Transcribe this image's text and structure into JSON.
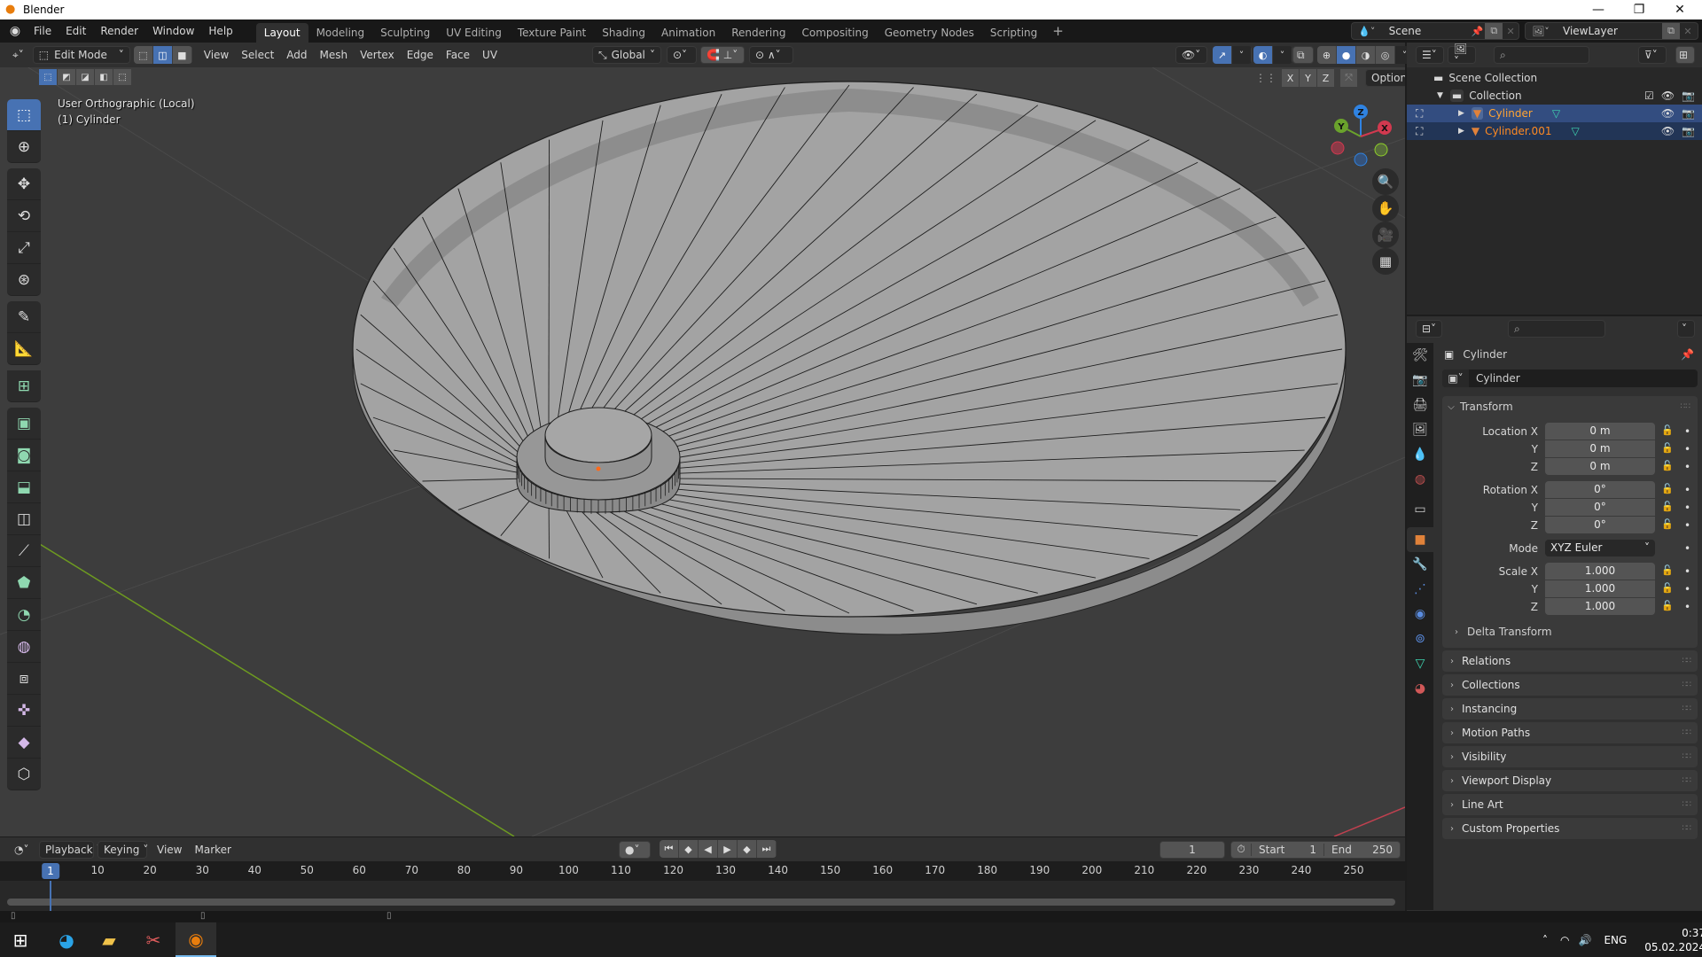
{
  "window": {
    "title": "Blender",
    "controls": [
      "minimize",
      "restore",
      "close"
    ]
  },
  "topbar": {
    "menus": [
      "File",
      "Edit",
      "Render",
      "Window",
      "Help"
    ],
    "workspaces": [
      "Layout",
      "Modeling",
      "Sculpting",
      "UV Editing",
      "Texture Paint",
      "Shading",
      "Animation",
      "Rendering",
      "Compositing",
      "Geometry Nodes",
      "Scripting"
    ],
    "active_workspace": "Layout",
    "add_workspace": "+",
    "scene": "Scene",
    "view_layer": "ViewLayer"
  },
  "viewport_header": {
    "mode": "Edit Mode",
    "menus": [
      "View",
      "Select",
      "Add",
      "Mesh",
      "Vertex",
      "Edge",
      "Face",
      "UV"
    ],
    "transform_orientation": "Global",
    "select_mode_active": "edge",
    "shading_active": "solid",
    "options_label": "Options",
    "axis_buttons": [
      "X",
      "Y",
      "Z"
    ]
  },
  "viewport": {
    "view_name": "User Orthographic (Local)",
    "object_info": "(1) Cylinder",
    "gizmo": {
      "x": "X",
      "y": "Y",
      "z": "Z"
    },
    "colors": {
      "background": "#3d3d3d",
      "mesh_face": "#a5a5a5",
      "mesh_side": "#8c8c8c",
      "grid_x": "#c0404f",
      "grid_y": "#6e9b20",
      "selection": "#4772b3",
      "active_vertex": "#ff6a1a"
    }
  },
  "toolbar": {
    "tools": [
      "select-box",
      "cursor",
      "move",
      "rotate",
      "scale",
      "transform",
      "annotate",
      "measure",
      "add-cube",
      "extrude-region",
      "inset-faces",
      "bevel",
      "loop-cut",
      "knife",
      "poly-build",
      "spin",
      "smooth",
      "edge-slide",
      "shrink-fatten",
      "shear",
      "rip-region"
    ],
    "active_tool": "select-box"
  },
  "outliner": {
    "root": "Scene Collection",
    "collection": "Collection",
    "objects": [
      {
        "name": "Cylinder",
        "selected": true,
        "active": true
      },
      {
        "name": "Cylinder.001",
        "selected": true,
        "active": false
      }
    ]
  },
  "properties": {
    "object_name_header": "Cylinder",
    "object_name_field": "Cylinder",
    "transform_title": "Transform",
    "location": {
      "label": "Location X",
      "x": "0 m",
      "y": "0 m",
      "z": "0 m"
    },
    "rotation": {
      "label": "Rotation X",
      "x": "0°",
      "y": "0°",
      "z": "0°"
    },
    "mode": {
      "label": "Mode",
      "value": "XYZ Euler"
    },
    "scale": {
      "label": "Scale X",
      "x": "1.000",
      "y": "1.000",
      "z": "1.000"
    },
    "axis_labels": {
      "y": "Y",
      "z": "Z"
    },
    "delta_transform": "Delta Transform",
    "panels": [
      "Relations",
      "Collections",
      "Instancing",
      "Motion Paths",
      "Visibility",
      "Viewport Display",
      "Line Art",
      "Custom Properties"
    ]
  },
  "timeline": {
    "menus": [
      "Playback",
      "Keying",
      "View",
      "Marker"
    ],
    "current_frame": "1",
    "start_label": "Start",
    "start": "1",
    "end_label": "End",
    "end": "250",
    "ruler_ticks": [
      "10",
      "20",
      "30",
      "40",
      "50",
      "60",
      "70",
      "80",
      "90",
      "100",
      "110",
      "120",
      "130",
      "140",
      "150",
      "160",
      "170",
      "180",
      "190",
      "200",
      "210",
      "220",
      "230",
      "240",
      "250"
    ],
    "playhead": "1"
  },
  "taskbar": {
    "apps": [
      "Start",
      "Microsoft Edge",
      "File Explorer",
      "Snipping Tool",
      "Blender"
    ],
    "active_app": "Blender",
    "language": "ENG",
    "time": "0:37",
    "date": "05.02.2024"
  }
}
